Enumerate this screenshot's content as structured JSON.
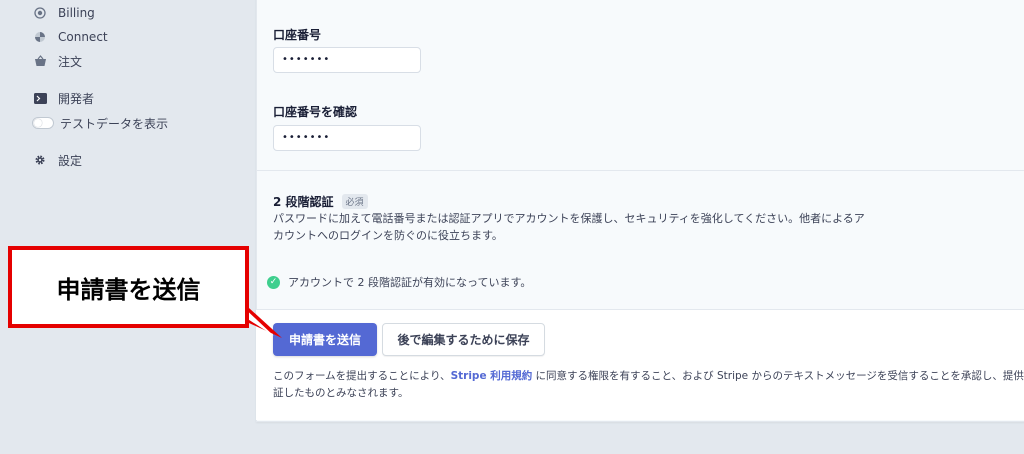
{
  "sidebar": {
    "items": [
      {
        "label": "Billing",
        "icon": "billing-icon"
      },
      {
        "label": "Connect",
        "icon": "connect-icon"
      },
      {
        "label": "注文",
        "icon": "orders-basket-icon"
      },
      {
        "label": "開発者",
        "icon": "terminal-icon"
      },
      {
        "label": "テストデータを表示",
        "icon": "toggle"
      },
      {
        "label": "設定",
        "icon": "gear-icon"
      }
    ]
  },
  "form": {
    "account_number_label": "口座番号",
    "account_number_value": "•••••••",
    "confirm_label": "口座番号を確認",
    "confirm_value": "•••••••"
  },
  "twofa": {
    "title": "2 段階認証",
    "badge": "必須",
    "description": "パスワードに加えて電話番号または認証アプリでアカウントを保護し、セキュリティを強化してください。他者によるアカウントへのログインを防ぐのに役立ちます。",
    "status": "アカウントで 2 段階認証が有効になっています。"
  },
  "actions": {
    "submit_label": "申請書を送信",
    "save_later_label": "後で編集するために保存"
  },
  "legal": {
    "prefix": "このフォームを提出することにより、",
    "link": "Stripe 利用規約",
    "suffix": " に同意する権限を有すること、および Stripe からのテキストメッセージを受信することを承認し、提供された情",
    "line2": "証したものとみなされます。"
  },
  "annotation": {
    "callout_text": "申請書を送信"
  },
  "colors": {
    "primary": "#5469d4",
    "success": "#3ecf8e",
    "callout_border": "#e50000"
  }
}
